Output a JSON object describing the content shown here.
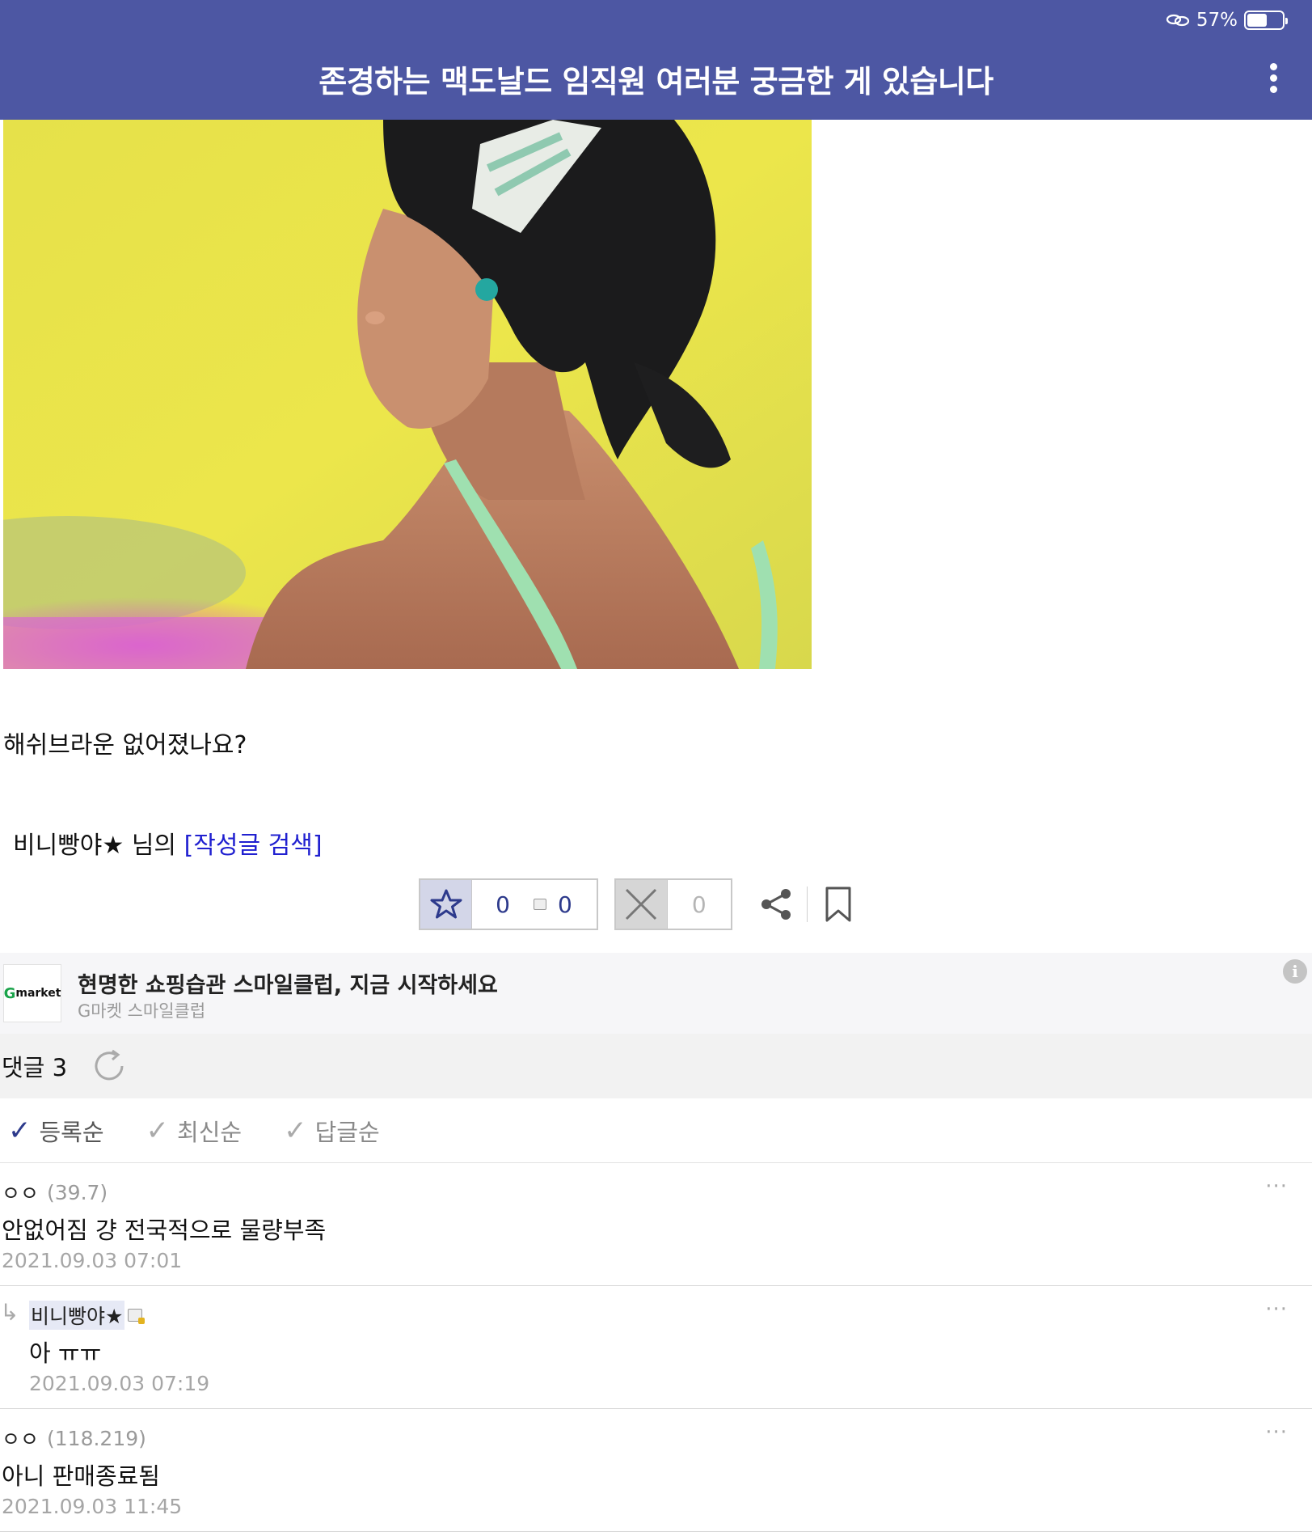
{
  "status": {
    "battery": "57%",
    "battery_level": 0.57
  },
  "header": {
    "title": "존경하는 맥도날드 임직원 여러분 궁금한 게 있습니다"
  },
  "post": {
    "body": "해쉬브라운 없어졌나요?",
    "author": "비니빵야★",
    "author_suffix": " 님의 ",
    "search_link": "[작성글 검색]"
  },
  "actions": {
    "recommend_count": "0",
    "fixed_recommend_count": "0",
    "downvote_count": "0"
  },
  "ad": {
    "logo_g": "G",
    "logo_text": "market",
    "title": "현명한 쇼핑습관 스마일클럽, 지금 시작하세요",
    "subtitle": "G마켓 스마일클럽",
    "info": "i"
  },
  "comments_header": {
    "label": "댓글 3"
  },
  "sort": {
    "options": [
      "등록순",
      "최신순",
      "답글순"
    ]
  },
  "comments": [
    {
      "name": "ㅇㅇ",
      "ip": "(39.7)",
      "body": "안없어짐 걍 전국적으로 물량부족",
      "date": "2021.09.03 07:01"
    },
    {
      "name": "비니빵야★",
      "ip": "",
      "body": "아 ㅠㅠ",
      "date": "2021.09.03 07:19",
      "reply": "↳"
    },
    {
      "name": "ㅇㅇ",
      "ip": "(118.219)",
      "body": "아니 판매종료됨",
      "date": "2021.09.03 11:45"
    }
  ],
  "more_label": "···",
  "colors": {
    "header_bg": "#4d57a3",
    "accent": "#2d3a8c",
    "link": "#2020d0"
  }
}
